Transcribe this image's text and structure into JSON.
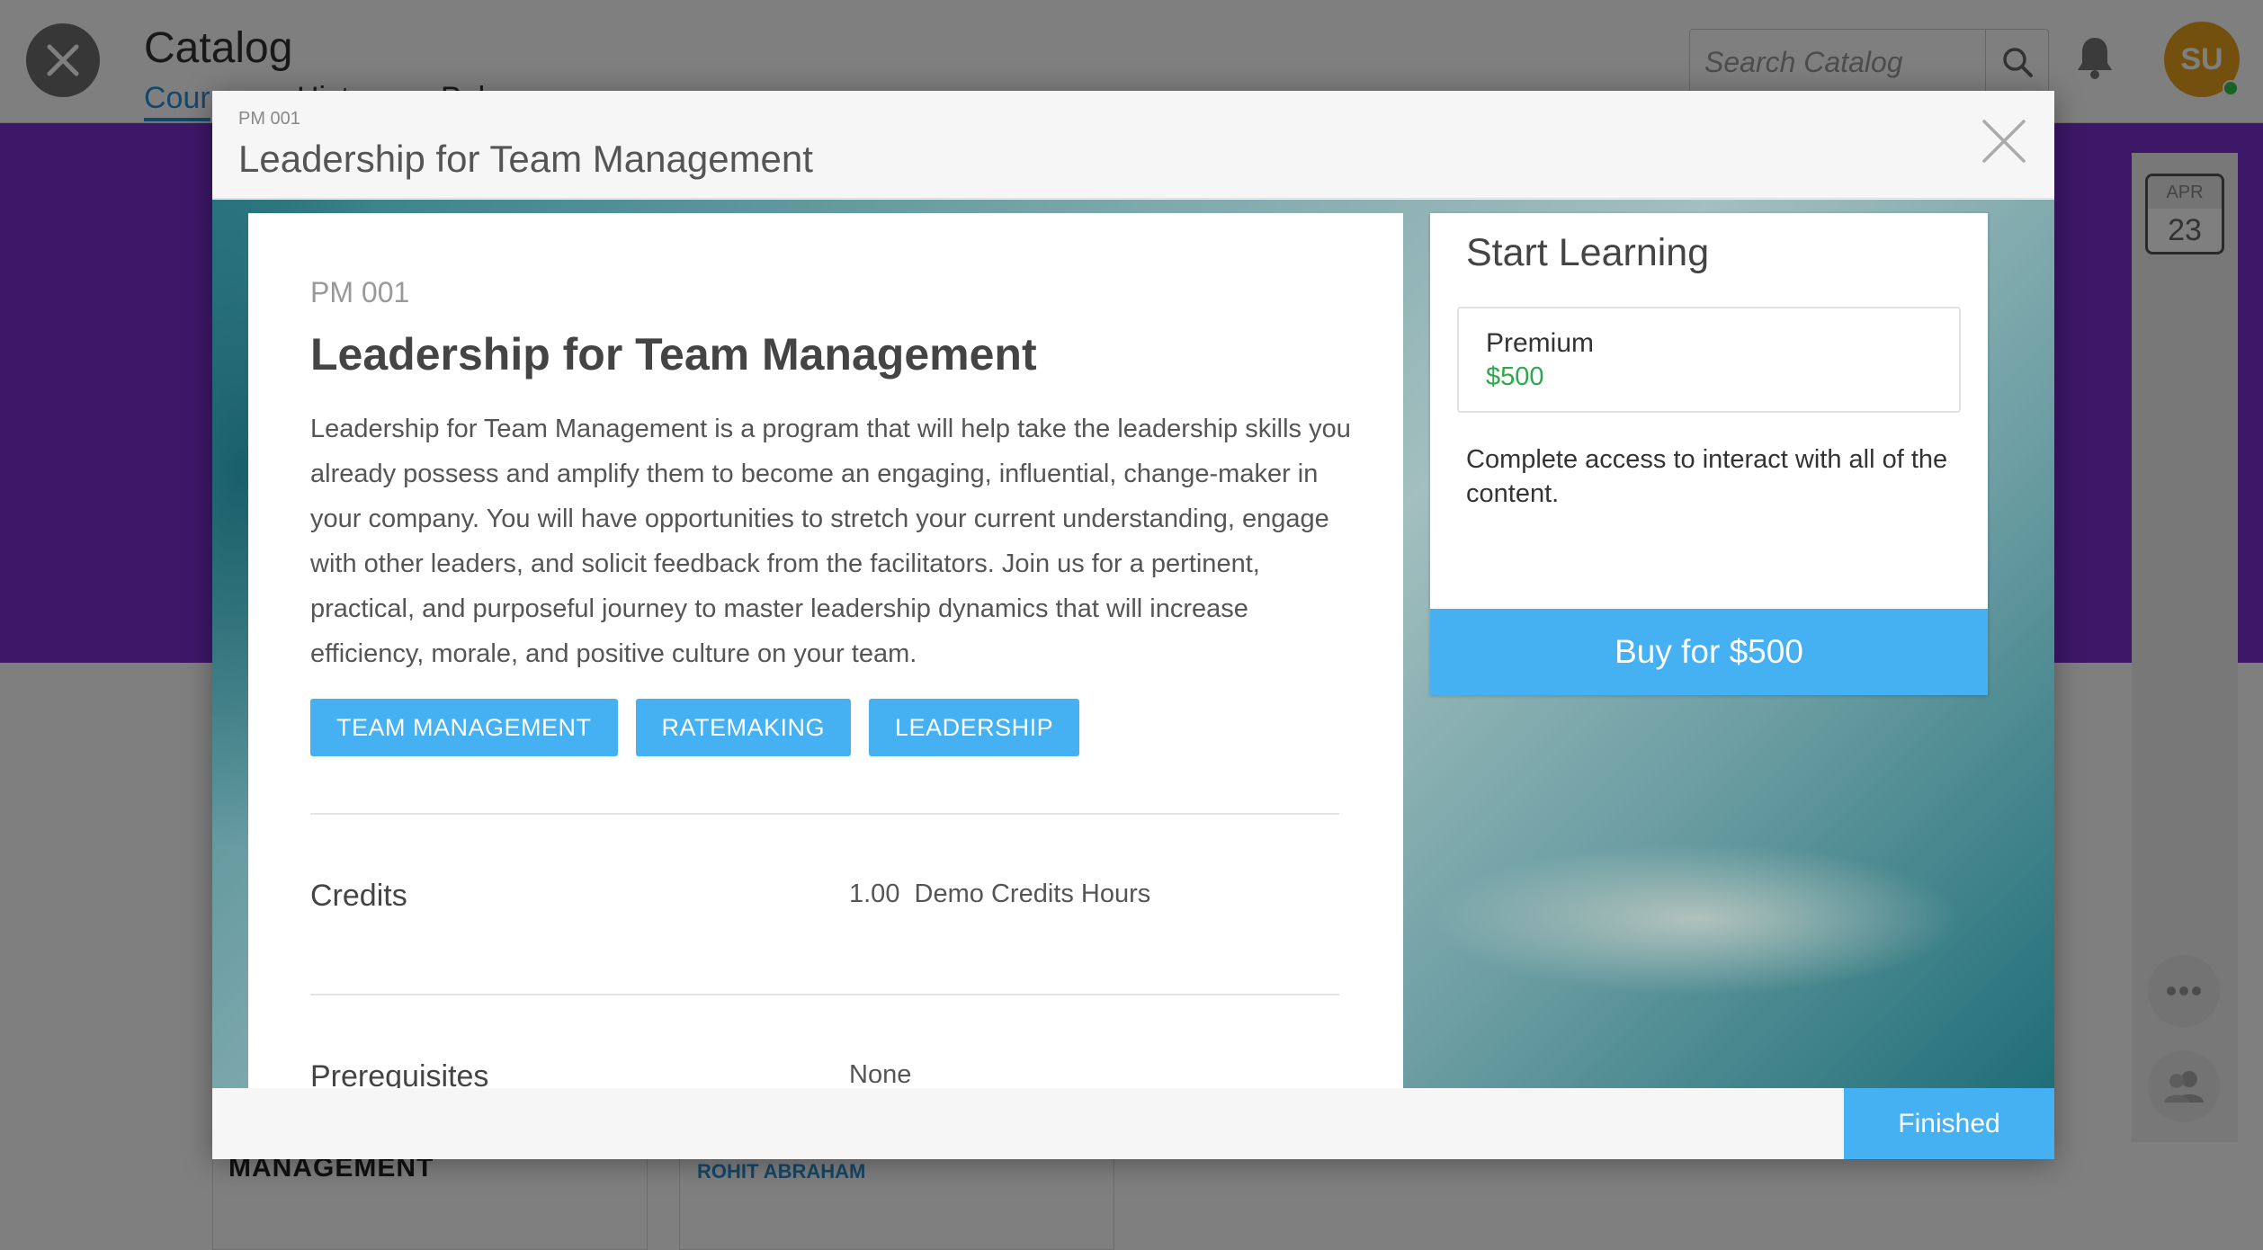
{
  "app": {
    "title": "Catalog",
    "tabs": [
      {
        "label": "Cour"
      },
      {
        "label": "Hist"
      },
      {
        "label": "Pub"
      }
    ],
    "search_placeholder": "Search Catalog",
    "avatar_initials": "SU",
    "calendar": {
      "month": "APR",
      "day": "23"
    },
    "background_card": {
      "title": "MANAGEMENT",
      "author": "ROHIT ABRAHAM"
    }
  },
  "modal": {
    "code": "PM 001",
    "title": "Leadership for Team Management",
    "course": {
      "code": "PM 001",
      "title": "Leadership for Team Management",
      "description": "Leadership for Team Management is a program that will help take the leadership skills you already possess and amplify them to become an engaging, influential, change-maker in your company. You will have opportunities to stretch your current understanding, engage with other leaders, and solicit feedback from the facilitators. Join us for a pertinent, practical, and purposeful journey to master leadership dynamics that will increase efficiency, morale, and positive culture on your team.",
      "tags": [
        "TEAM MANAGEMENT",
        "RATEMAKING",
        "LEADERSHIP"
      ],
      "details": [
        {
          "label": "Credits",
          "value": "1.00  Demo Credits Hours"
        },
        {
          "label": "Prerequisites",
          "value": "None"
        }
      ]
    },
    "start_learning": {
      "title": "Start Learning",
      "plan_name": "Premium",
      "plan_price": "$500",
      "plan_description": "Complete access to interact with all of the content.",
      "buy_label": "Buy for $500"
    },
    "finished_label": "Finished"
  },
  "colors": {
    "accent": "#45b0f2",
    "price_green": "#2ea84b",
    "hero_purple": "#7a2fd0",
    "avatar_orange": "#e9a11f"
  }
}
